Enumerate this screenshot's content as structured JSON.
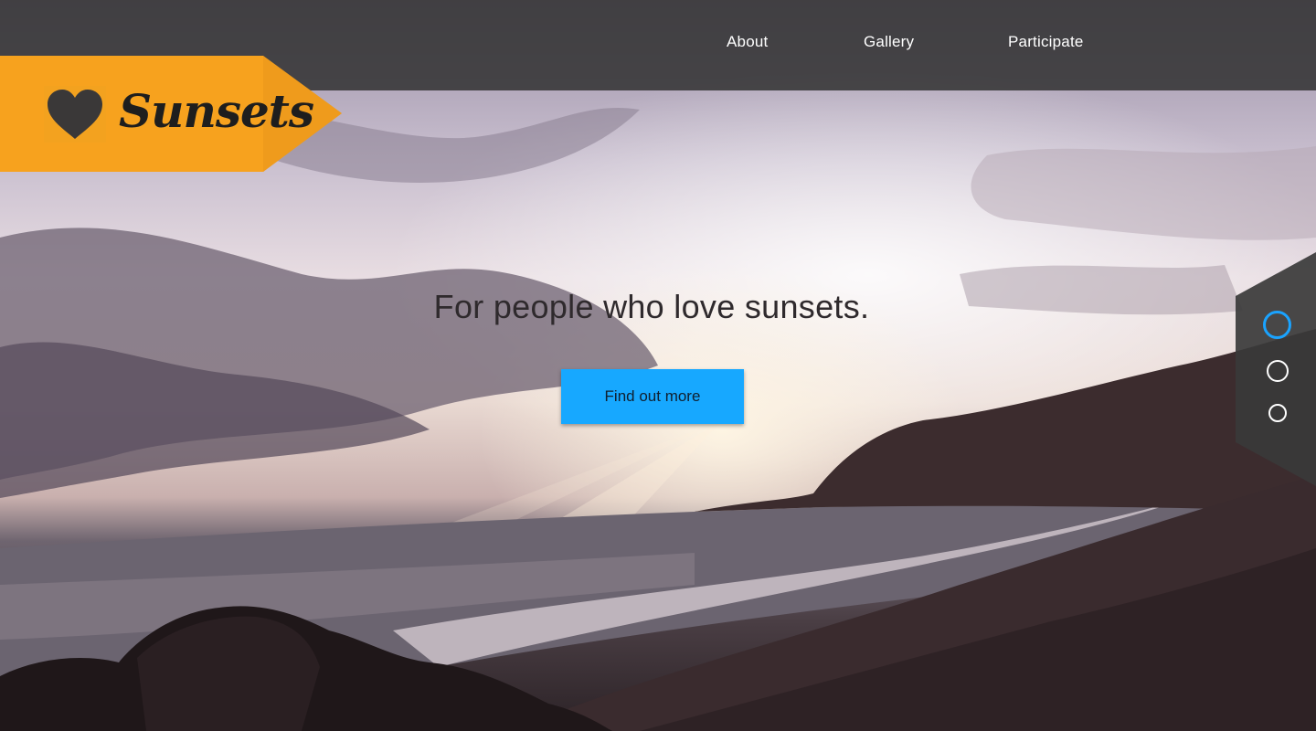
{
  "brand": {
    "name": "Sunsets",
    "color": "#f3a21f"
  },
  "nav": {
    "items": [
      {
        "label": "About"
      },
      {
        "label": "Gallery"
      },
      {
        "label": "Participate"
      }
    ]
  },
  "hero": {
    "headline": "For people who love sunsets.",
    "cta_label": "Find out more",
    "cta_color": "#17a8ff",
    "background": "beach-sunset-photo"
  },
  "pagination": {
    "count": 3,
    "active_index": 0,
    "active_color": "#1aa3ff"
  },
  "icons": {
    "logo": "heart-icon"
  }
}
